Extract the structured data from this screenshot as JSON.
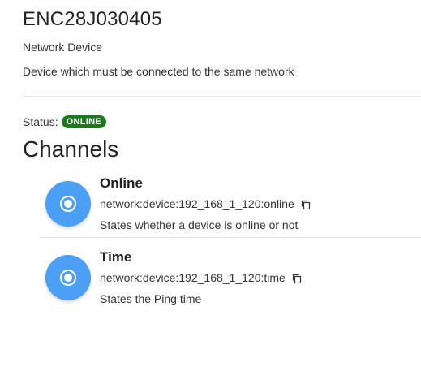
{
  "thing": {
    "title": "ENC28J030405",
    "subtitle": "Network Device",
    "description": "Device which must be connected to the same network",
    "status_label": "Status:",
    "status_value": "ONLINE",
    "status_color": "#1b7a1b"
  },
  "channels": {
    "heading": "Channels",
    "accent_color": "#4b9ff5",
    "items": [
      {
        "label": "Online",
        "uid": "network:device:192_168_1_120:online",
        "description": "States whether a device is online or not",
        "icon": "radio-button-icon",
        "copy_icon": "copy-icon"
      },
      {
        "label": "Time",
        "uid": "network:device:192_168_1_120:time",
        "description": "States the Ping time",
        "icon": "radio-button-icon",
        "copy_icon": "copy-icon"
      }
    ]
  }
}
